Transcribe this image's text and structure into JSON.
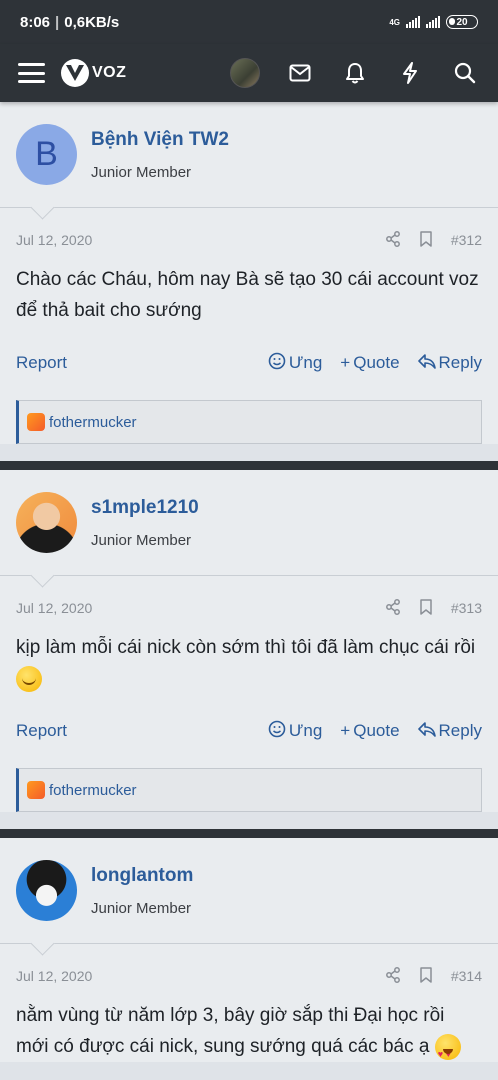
{
  "status_bar": {
    "time": "8:06",
    "net_speed": "0,6KB/s",
    "network_type": "4G",
    "battery": "20"
  },
  "navbar": {
    "logo_text": "VOZ"
  },
  "posts": [
    {
      "avatar_letter": "B",
      "username": "Bệnh Viện TW2",
      "title": "Junior Member",
      "date": "Jul 12, 2020",
      "number": "#312",
      "text": "Chào các Cháu, hôm nay Bà sẽ tạo 30 cái account voz để thả bait cho sướng",
      "report": "Report",
      "ung": "Ưng",
      "quote": "Quote",
      "reply": "Reply",
      "reaction_user": "fothermucker"
    },
    {
      "username": "s1mple1210",
      "title": "Junior Member",
      "date": "Jul 12, 2020",
      "number": "#313",
      "text": "kịp làm mỗi cái nick còn sớm thì tôi đã làm chục cái rồi",
      "report": "Report",
      "ung": "Ưng",
      "quote": "Quote",
      "reply": "Reply",
      "reaction_user": "fothermucker"
    },
    {
      "username": "longlantom",
      "title": "Junior Member",
      "date": "Jul 12, 2020",
      "number": "#314",
      "text": "nằm vùng từ năm lớp 3, bây giờ sắp thi Đại học rồi mới có được cái nick, sung sướng quá các bác ạ"
    }
  ],
  "colors": {
    "nav_bg": "#2e3338",
    "link": "#2c5c9a",
    "post_bg": "#e9ecef"
  }
}
